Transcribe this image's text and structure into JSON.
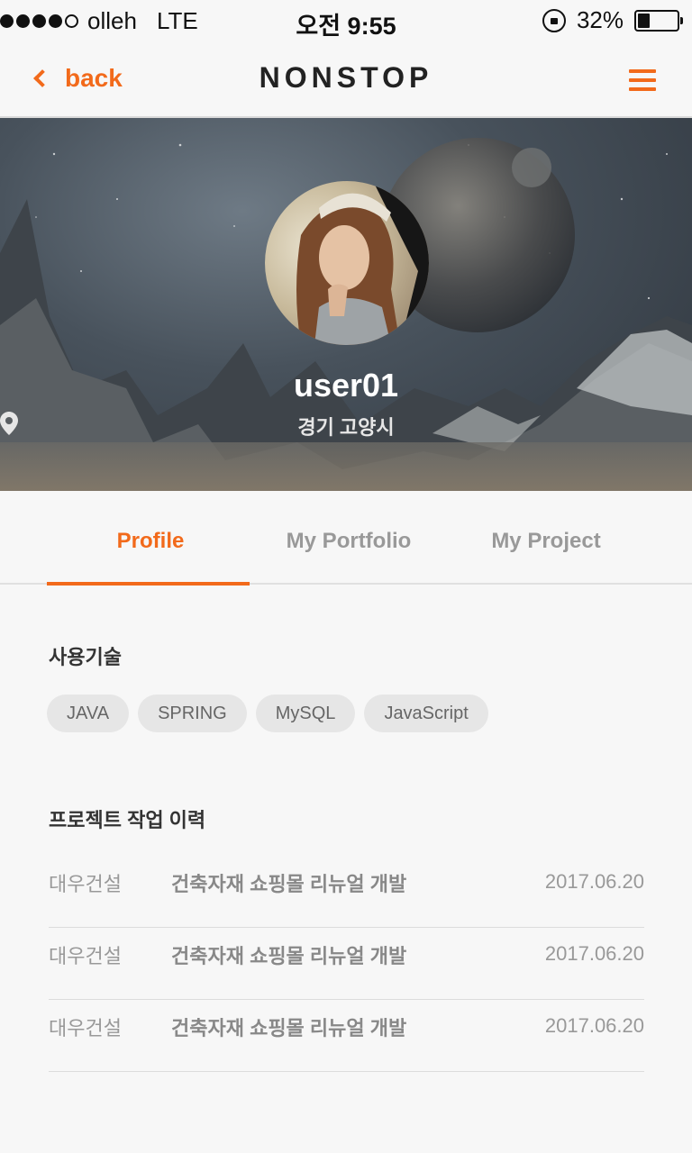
{
  "status_bar": {
    "carrier": "olleh",
    "network": "LTE",
    "time": "오전 9:55",
    "battery_text": "32%",
    "battery_level": 0.32
  },
  "nav": {
    "back_label": "back",
    "title": "NONSTOP",
    "accent_color": "#f26a1b"
  },
  "profile": {
    "username": "user01",
    "location": "경기 고양시"
  },
  "tabs": [
    {
      "label": "Profile",
      "active": true
    },
    {
      "label": "My Portfolio",
      "active": false
    },
    {
      "label": "My Project",
      "active": false
    }
  ],
  "skills": {
    "title": "사용기술",
    "items": [
      "JAVA",
      "SPRING",
      "MySQL",
      "JavaScript"
    ]
  },
  "history": {
    "title": "프로젝트 작업 이력",
    "rows": [
      {
        "company": "대우건설",
        "project": "건축자재 쇼핑몰 리뉴얼 개발",
        "date": "2017.06.20"
      },
      {
        "company": "대우건설",
        "project": "건축자재 쇼핑몰 리뉴얼 개발",
        "date": "2017.06.20"
      },
      {
        "company": "대우건설",
        "project": "건축자재 쇼핑몰 리뉴얼 개발",
        "date": "2017.06.20"
      }
    ]
  }
}
